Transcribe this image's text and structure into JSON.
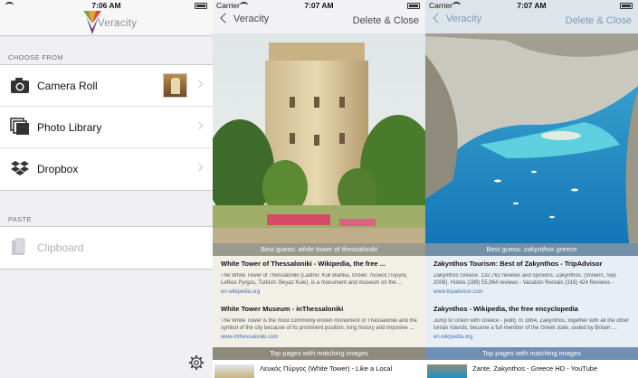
{
  "screens": [
    {
      "status": {
        "carrier": "",
        "time": "7:06 AM"
      },
      "brand": "Veracity",
      "choose_from": "CHOOSE FROM",
      "items": [
        {
          "label": "Camera Roll",
          "icon": "camera-icon"
        },
        {
          "label": "Photo Library",
          "icon": "photo-library-icon"
        },
        {
          "label": "Dropbox",
          "icon": "dropbox-icon"
        }
      ],
      "paste": "PASTE",
      "clipboard": "Clipboard"
    },
    {
      "status": {
        "carrier": "Carrier",
        "time": "7:07 AM"
      },
      "back": "Veracity",
      "action": "Delete & Close",
      "guess_prefix": "Best guess: ",
      "guess": "white tower of thessaloniki",
      "results": [
        {
          "title": "White Tower of Thessaloniki - Wikipedia, the free ...",
          "desc": "The White Tower of Thessaloniki (Ladino: Kuli Blanka, Greek: Λευκός Πύργος Lefkos Pyrgos, Turkish: Beyaz Kule), is a monument and museum on the ...",
          "url": "en.wikipedia.org"
        },
        {
          "title": "White Tower Museum - inThessaloniki",
          "desc": "The White Tower is the most commonly known monument of Thessaloniki and the symbol of the city because of its prominent position, long history and imposive ...",
          "url": "www.inthessaloniki.com"
        }
      ],
      "pages_label": "Top pages with matching images",
      "page": "Λευκός Πύργος (White Tower) - Like a Local"
    },
    {
      "status": {
        "carrier": "Carrier",
        "time": "7:07 AM"
      },
      "back": "Veracity",
      "action": "Delete & Close",
      "guess_prefix": "Best guess: ",
      "guess": "zakynthos greece",
      "results": [
        {
          "title": "Zakynthos Tourism: Best of Zakynthos - TripAdvisor",
          "desc": "Zakynthos Greece. 132,762 reviews and opinions. Zakynthos. (Vivienn, Sep 2008). Hotels (289) 55,864 reviews - Vacation Rentals (316) 424 Reviews - Flights ...",
          "url": "www.tripadvisor.com"
        },
        {
          "title": "Zakynthos - Wikipedia, the free encyclopedia",
          "desc": "Jump to Union with Greece - [edit]. In 1864, Zakynthos, together with all the other Ionian Islands, became a full member of the Greek state, ceded by Britain ...",
          "url": "en.wikipedia.org"
        }
      ],
      "pages_label": "Top pages with matching images",
      "page": "Zante, Zakynthos - Greece HD - YouTube"
    }
  ]
}
